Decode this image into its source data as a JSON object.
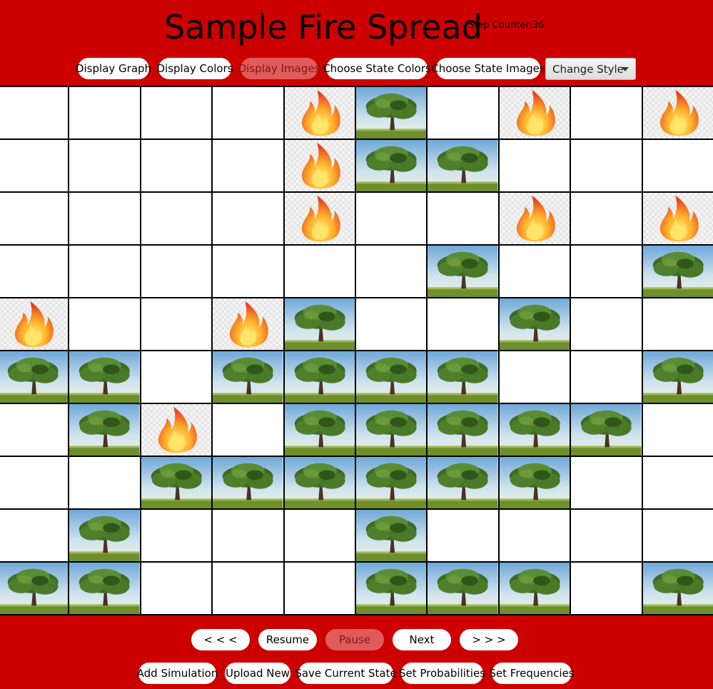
{
  "header": {
    "title": "Sample Fire Spread",
    "step_counter": "Step Counter:36"
  },
  "toolbar": {
    "display_graph": "Display Graph",
    "display_colors": "Display Colors",
    "display_images": "Display Images",
    "choose_state_colors": "Choose State Colors",
    "choose_state_images": "Choose State Images",
    "change_style": "Change Style"
  },
  "grid": {
    "rows": 10,
    "cols": 10,
    "legend": {
      "E": "empty",
      "T": "tree-image",
      "F": "fire-image"
    },
    "cells": [
      "EEEEFTEFEF",
      "EEEEFTTEEE",
      "EEEEFEEFEF",
      "EEEEEETEET",
      "FEEFTEETEE",
      "TTETTTTEET",
      "ETFETTTTTE",
      "EETTTTTTEE",
      "ETEEETEEEE",
      "TTEEETTTET"
    ]
  },
  "controls": {
    "back": "< < <",
    "resume": "Resume",
    "pause": "Pause",
    "next": "Next",
    "forward": "> > >"
  },
  "bottom": {
    "add_simulation": "Add Simulation",
    "upload_new": "Upload New",
    "save_current_state": "Save Current State",
    "set_probabilities": "Set Probabilities",
    "set_frequencies": "Set Frequencies"
  },
  "colors": {
    "background": "#cc0000",
    "active_button": "#e35a5a",
    "grid_line": "#000000"
  }
}
